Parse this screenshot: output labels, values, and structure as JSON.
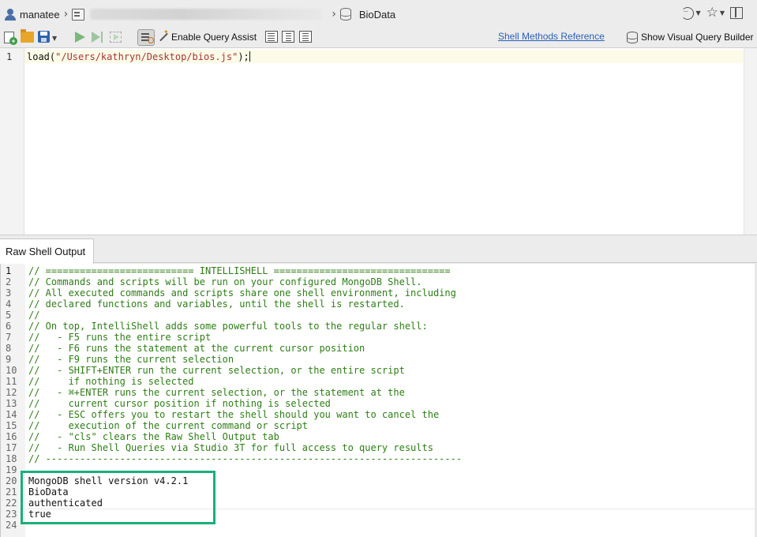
{
  "breadcrumb": {
    "user": "manatee",
    "database": "BioData"
  },
  "toolbar": {
    "enable_query_assist": "Enable Query Assist",
    "shell_methods_reference": "Shell Methods Reference",
    "show_visual_query_builder": "Show Visual Query Builder"
  },
  "editor": {
    "line_number": "1",
    "code_prefix": "load(",
    "code_string": "\"/Users/kathryn/Desktop/bios.js\"",
    "code_suffix": ");"
  },
  "output_tab": {
    "label": "Raw Shell Output"
  },
  "output_lines": [
    {
      "n": "1",
      "t": "// ========================== INTELLISHELL ==============================="
    },
    {
      "n": "2",
      "t": "// Commands and scripts will be run on your configured MongoDB Shell."
    },
    {
      "n": "3",
      "t": "// All executed commands and scripts share one shell environment, including"
    },
    {
      "n": "4",
      "t": "// declared functions and variables, until the shell is restarted."
    },
    {
      "n": "5",
      "t": "//"
    },
    {
      "n": "6",
      "t": "// On top, IntelliShell adds some powerful tools to the regular shell:"
    },
    {
      "n": "7",
      "t": "//   - F5 runs the entire script"
    },
    {
      "n": "8",
      "t": "//   - F6 runs the statement at the current cursor position"
    },
    {
      "n": "9",
      "t": "//   - F9 runs the current selection"
    },
    {
      "n": "10",
      "t": "//   - SHIFT+ENTER run the current selection, or the entire script"
    },
    {
      "n": "11",
      "t": "//     if nothing is selected"
    },
    {
      "n": "12",
      "t": "//   - ⌘+ENTER runs the current selection, or the statement at the"
    },
    {
      "n": "13",
      "t": "//     current cursor position if nothing is selected"
    },
    {
      "n": "14",
      "t": "//   - ESC offers you to restart the shell should you want to cancel the"
    },
    {
      "n": "15",
      "t": "//     execution of the current command or script"
    },
    {
      "n": "16",
      "t": "//   - \"cls\" clears the Raw Shell Output tab"
    },
    {
      "n": "17",
      "t": "//   - Run Shell Queries via Studio 3T for full access to query results"
    },
    {
      "n": "18",
      "t": "// -------------------------------------------------------------------------"
    },
    {
      "n": "19",
      "t": ""
    },
    {
      "n": "20",
      "t": "MongoDB shell version v4.2.1"
    },
    {
      "n": "21",
      "t": "BioData"
    },
    {
      "n": "22",
      "t": "authenticated"
    },
    {
      "n": "23",
      "t": "true"
    },
    {
      "n": "24",
      "t": ""
    }
  ],
  "colors": {
    "comment": "#2e7d16",
    "link": "#2a5fb8",
    "highlight_box": "#19b07a"
  }
}
